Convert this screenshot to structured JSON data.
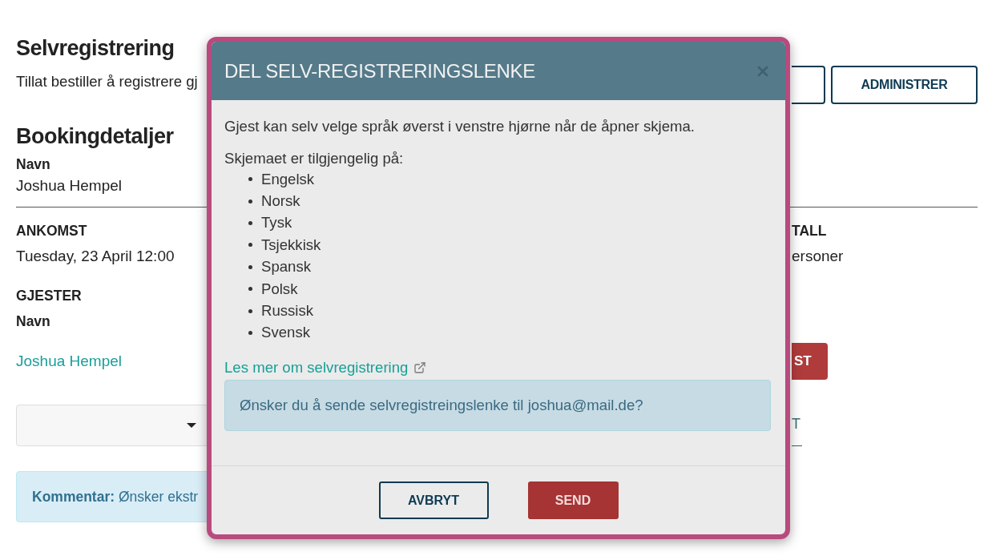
{
  "self_registration": {
    "title": "Selvregistrering",
    "description": "Tillat bestiller å registrere gj",
    "buttons": [
      {
        "kind": "blank"
      },
      {
        "kind": "text",
        "label": "ADMINISTRER"
      }
    ]
  },
  "booking_details": {
    "title": "Bookingdetaljer",
    "name_label": "Navn",
    "name": "Joshua Hempel",
    "arrival": {
      "label": "ANKOMST",
      "value": "Tuesday, 23 April 12:00"
    },
    "column_2": {
      "label": "TALL",
      "value": "ersoner"
    }
  },
  "guests": {
    "label": "GJESTER",
    "name_label": "Navn",
    "names": [
      "Joshua Hempel"
    ],
    "button_2": {
      "label": "ST"
    },
    "link_2": {
      "label": "T"
    }
  },
  "comment": {
    "text": "**Kommentar:** Ønsker ekstr"
  },
  "dialog": {
    "title": "DEL SELV-REGISTRERINGSLENKE",
    "intro": "Gjest kan selv velge språk øverst i venstre hjørne når de åpner skjema.",
    "languages_heading": "Skjemaet er tilgjengelig på:",
    "languages": [
      "Engelsk",
      "Norsk",
      "Tysk",
      "Tsjekkisk",
      "Spansk",
      "Polsk",
      "Russisk",
      "Svensk"
    ],
    "link": "Les mer om selvregistrering",
    "question": "Ønsker du å sende selvregistreingslenke til joshua@mail.de?",
    "buttons": [
      {
        "kind": "secondary",
        "label": "AVBRYT"
      },
      {
        "kind": "primary",
        "label": "SEND"
      }
    ]
  }
}
